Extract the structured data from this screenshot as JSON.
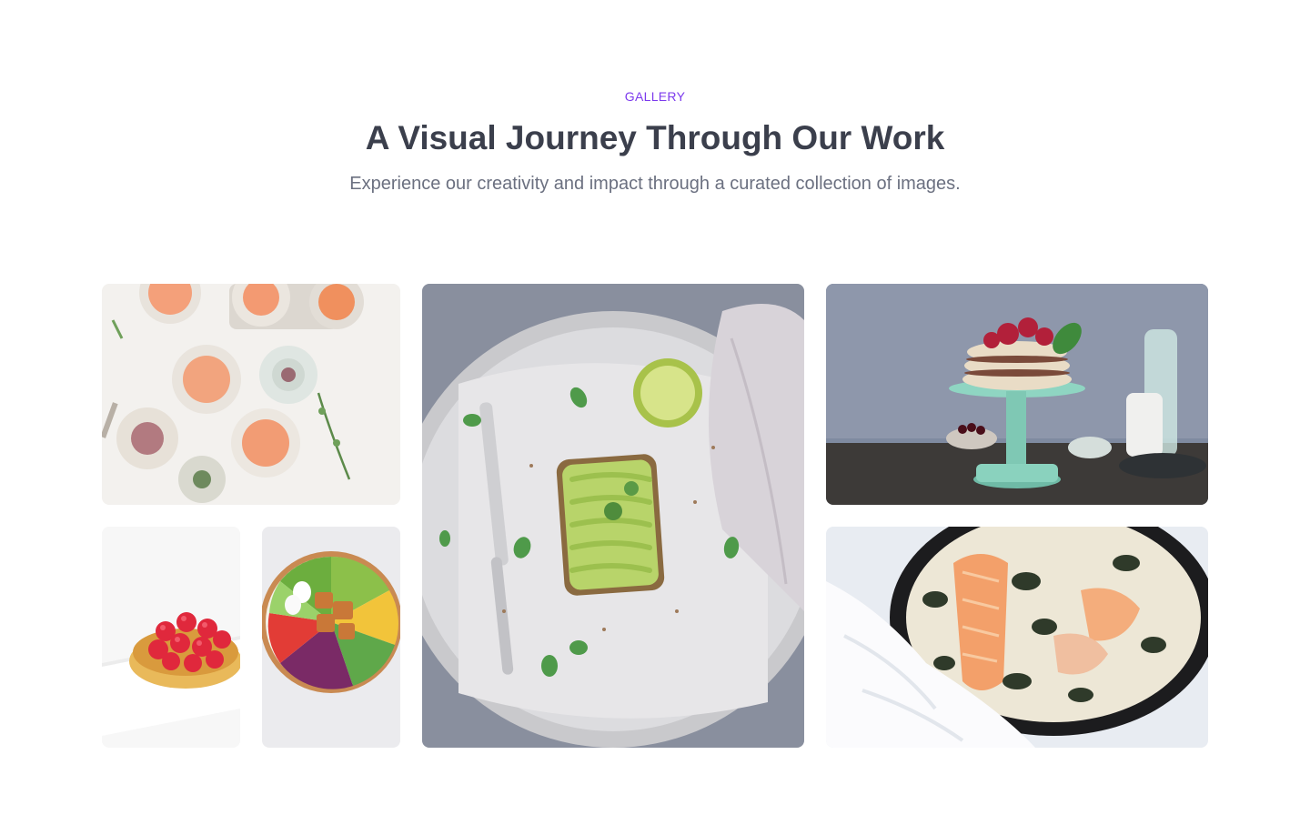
{
  "section": {
    "eyebrow": "GALLERY",
    "title": "A Visual Journey Through Our Work",
    "subtitle": "Experience our creativity and impact through a curated collection of images."
  },
  "colors": {
    "accent": "#7c3aed",
    "title": "#3b3f4c",
    "subtitle": "#6b7080"
  },
  "gallery": {
    "images": [
      {
        "id": "grapefruit-dishes",
        "description_icon": "food-photo"
      },
      {
        "id": "raspberry-tart",
        "description_icon": "food-photo"
      },
      {
        "id": "salad-bowl",
        "description_icon": "food-photo"
      },
      {
        "id": "avocado-toast",
        "description_icon": "food-photo"
      },
      {
        "id": "cherry-cake",
        "description_icon": "food-photo"
      },
      {
        "id": "salmon-skillet",
        "description_icon": "food-photo"
      }
    ]
  }
}
